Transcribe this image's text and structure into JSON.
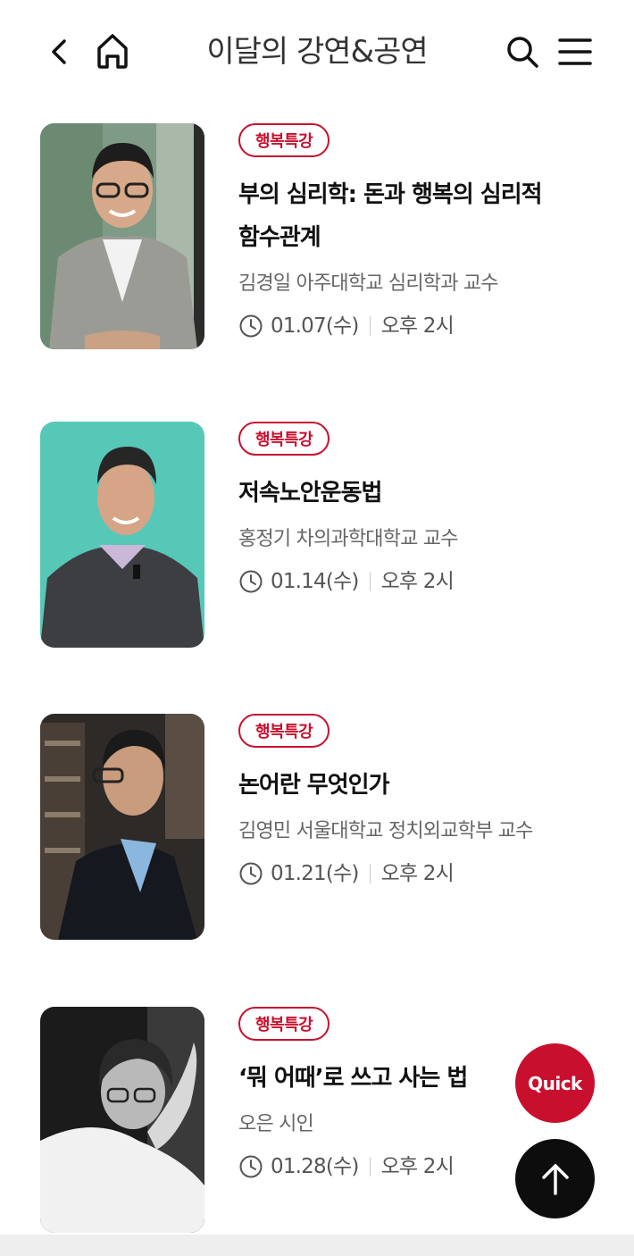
{
  "header": {
    "title": "이달의 강연&공연",
    "back_icon": "chevron-left-icon",
    "home_icon": "home-icon",
    "search_icon": "search-icon",
    "menu_icon": "hamburger-menu-icon"
  },
  "colors": {
    "accent": "#c8102e",
    "top_button": "#0d0d0d"
  },
  "events": [
    {
      "tag": "행복특강",
      "title": "부의 심리학: 돈과 행복의 심리적 함수관계",
      "speaker": "김경일 아주대학교 심리학과 교수",
      "date": "01.07(수)",
      "time": "오후 2시"
    },
    {
      "tag": "행복특강",
      "title": "저속노안운동법",
      "speaker": "홍정기 차의과학대학교 교수",
      "date": "01.14(수)",
      "time": "오후 2시"
    },
    {
      "tag": "행복특강",
      "title": "논어란 무엇인가",
      "speaker": "김영민 서울대학교 정치외교학부 교수",
      "date": "01.21(수)",
      "time": "오후 2시"
    },
    {
      "tag": "행복특강",
      "title": "‘뭐 어때’로 쓰고 사는 법",
      "speaker": "오은 시인",
      "date": "01.28(수)",
      "time": "오후 2시"
    }
  ],
  "floating": {
    "quick_label": "Quick",
    "top_icon": "arrow-up-icon"
  }
}
